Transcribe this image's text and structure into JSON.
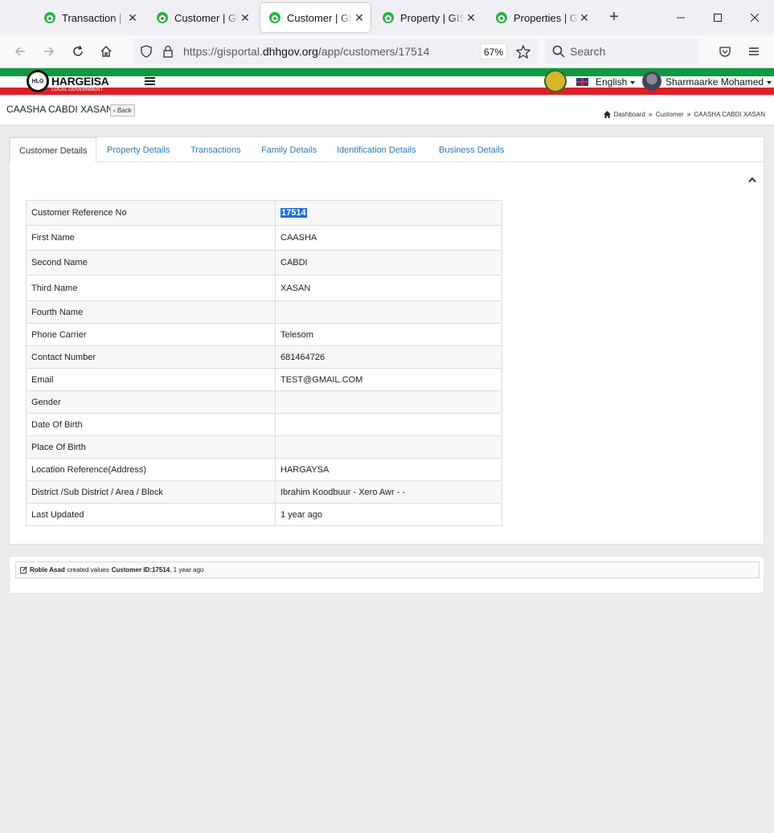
{
  "browser": {
    "tabs": [
      {
        "title": "Transaction | GIS Portal"
      },
      {
        "title": "Customer | GIS Portal"
      },
      {
        "title": "Customer | GIS Portal"
      },
      {
        "title": "Property | GIS Portal"
      },
      {
        "title": "Properties | GIS Portal"
      }
    ],
    "active_tab_index": 2,
    "url_prefix": "https://gisportal.",
    "url_domain": "dhhgov.org",
    "url_path": "/app/customers/17514",
    "zoom": "67%",
    "search_placeholder": "Search"
  },
  "header": {
    "logo_title": "HARGEISA",
    "logo_subtitle": "LOCAL GOVERNMENT",
    "language": "English",
    "user_name": "Sharmaarke Mohamed"
  },
  "page": {
    "title": "CAASHA CABDI XASAN",
    "back_label": "Back",
    "breadcrumb": [
      "Dashboard",
      "Customer",
      "CAASHA CABDI XASAN"
    ]
  },
  "tabs": [
    {
      "label": "Customer Details"
    },
    {
      "label": "Property Details"
    },
    {
      "label": "Transactions"
    },
    {
      "label": "Family Details"
    },
    {
      "label": "Identification Details"
    },
    {
      "label": "Business Details"
    }
  ],
  "customer": {
    "rows": [
      {
        "label": "Customer Reference No",
        "value": "17514"
      },
      {
        "label": "First Name",
        "value": "CAASHA"
      },
      {
        "label": "Second Name",
        "value": "CABDI"
      },
      {
        "label": "Third Name",
        "value": "XASAN"
      },
      {
        "label": "Fourth Name",
        "value": ""
      },
      {
        "label": "Phone Carrier",
        "value": "Telesom"
      },
      {
        "label": "Contact Number",
        "value": "681464726"
      },
      {
        "label": "Email",
        "value": "TEST@GMAIL.COM"
      },
      {
        "label": "Gender",
        "value": ""
      },
      {
        "label": "Date Of Birth",
        "value": ""
      },
      {
        "label": "Place Of Birth",
        "value": ""
      },
      {
        "label": "Location Reference(Address)",
        "value": "HARGAYSA"
      },
      {
        "label": "District /Sub District / Area / Block",
        "value": "Ibrahim Koodbuur - Xero Awr - -"
      },
      {
        "label": "Last Updated",
        "value": "1 year ago"
      }
    ]
  },
  "activity": {
    "user": "Roble Asad",
    "action": "created values",
    "target": "Customer ID:17514",
    "time": ", 1 year ago"
  },
  "colors": {
    "accent_link": "#2a7ab8",
    "flag_green": "#0f9a3c",
    "flag_red": "#e01e25",
    "selection": "#1e6fd9"
  }
}
